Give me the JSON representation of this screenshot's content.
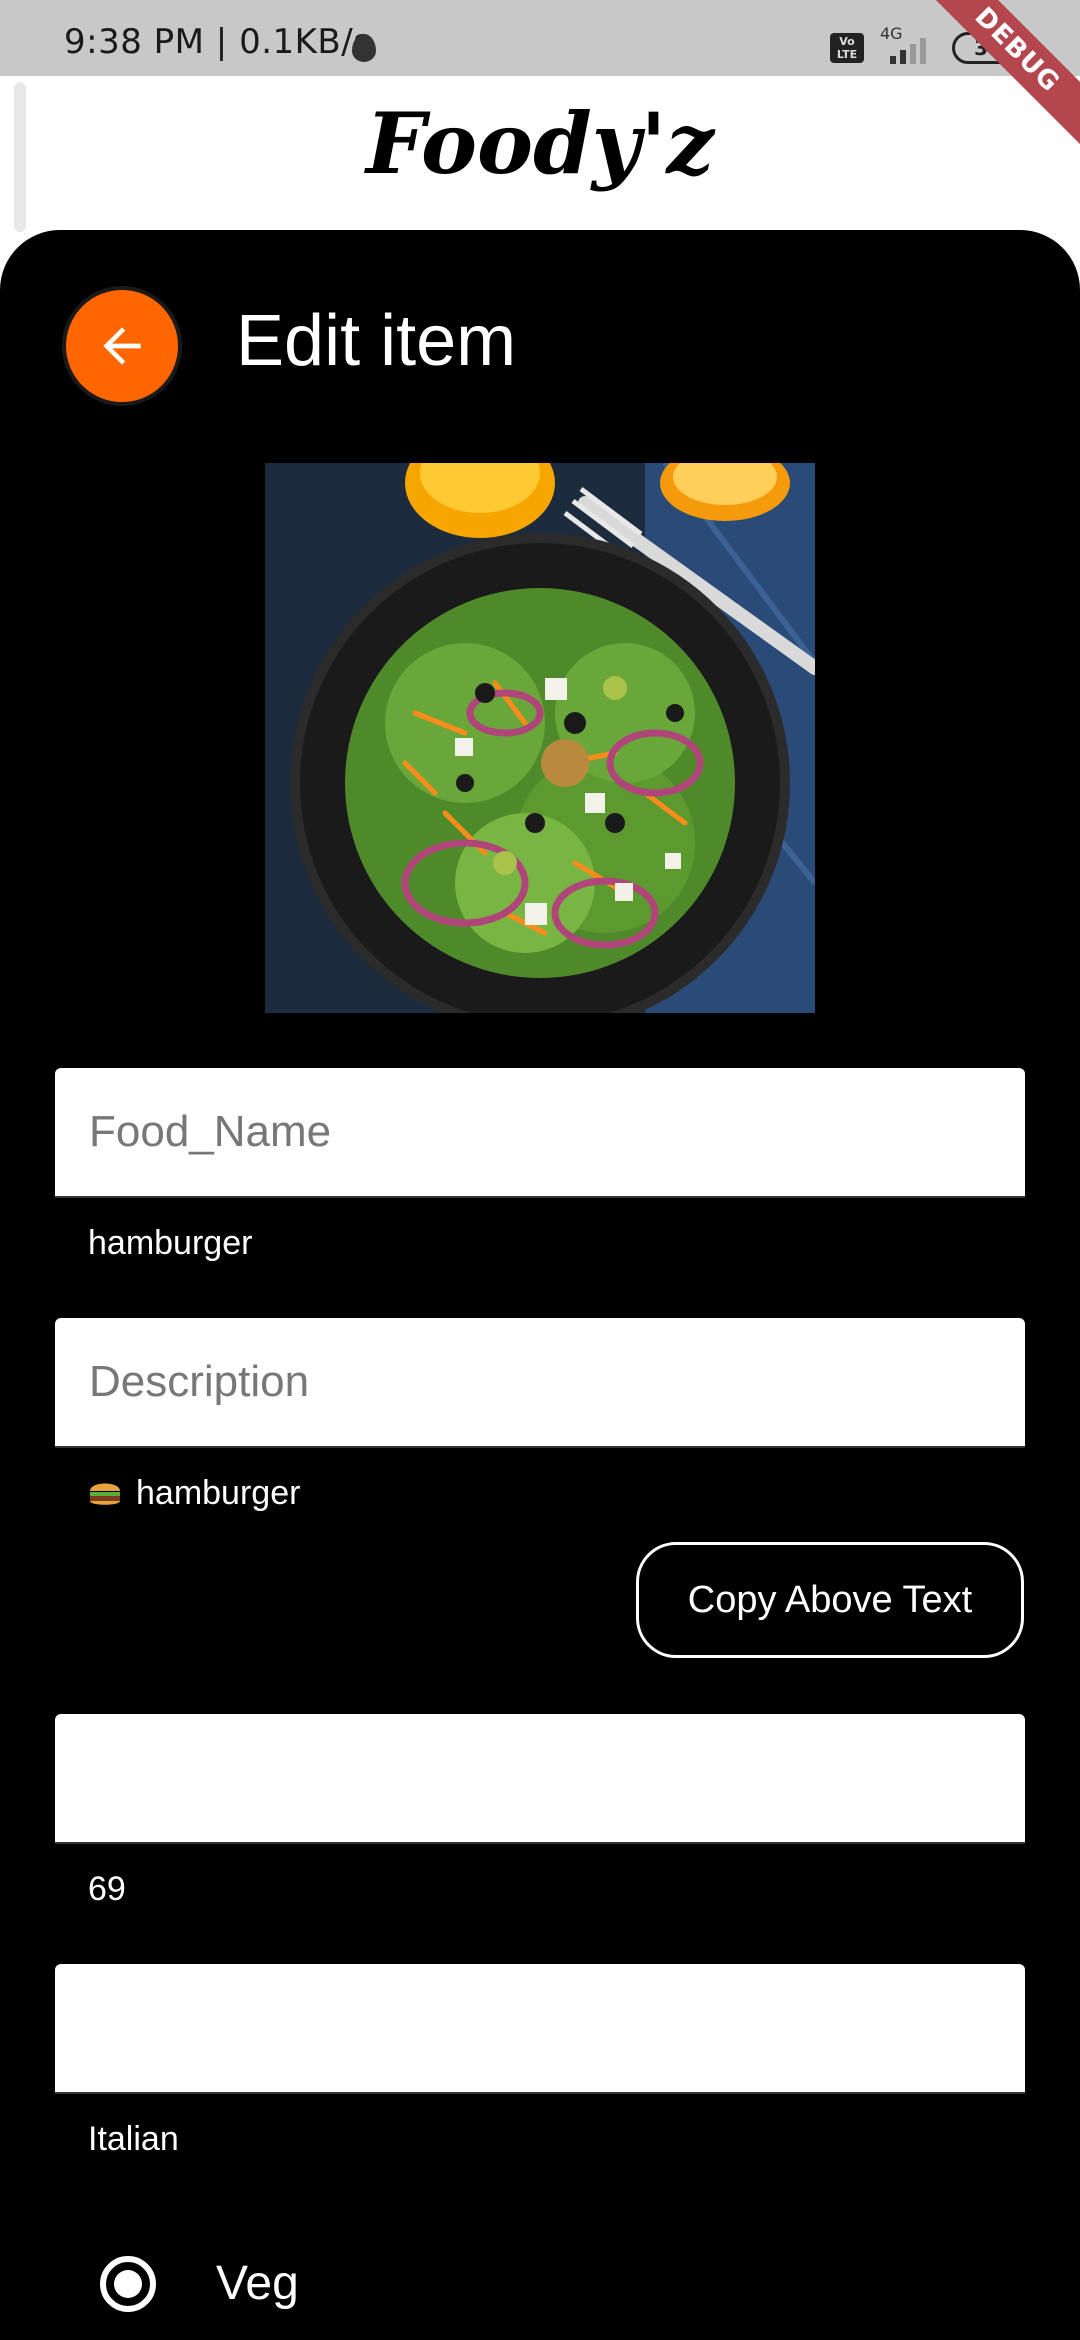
{
  "status_bar": {
    "time": "9:38 PM | 0.1KB/s",
    "network": "4G",
    "volte": "Vo LTE",
    "battery": "36",
    "debug_banner": "DEBUG"
  },
  "app_bar": {
    "title": "Foody'z"
  },
  "header": {
    "title": "Edit item",
    "back_icon": "arrow-left-icon"
  },
  "food_image": {
    "description": "salad-plate"
  },
  "form": {
    "food_name": {
      "placeholder": "Food_Name",
      "value": "hamburger"
    },
    "description": {
      "placeholder": "Description",
      "value": "hamburger",
      "emoji": "burger-emoji"
    },
    "copy_button_label": "Copy Above Text",
    "price": {
      "placeholder": "",
      "value": "69"
    },
    "cuisine": {
      "placeholder": "",
      "value": "Italian"
    },
    "veg_option": {
      "label": "Veg",
      "selected": true
    }
  },
  "colors": {
    "accent": "#ff6600",
    "panel": "#000000",
    "debug_ribbon": "#b4474e"
  }
}
